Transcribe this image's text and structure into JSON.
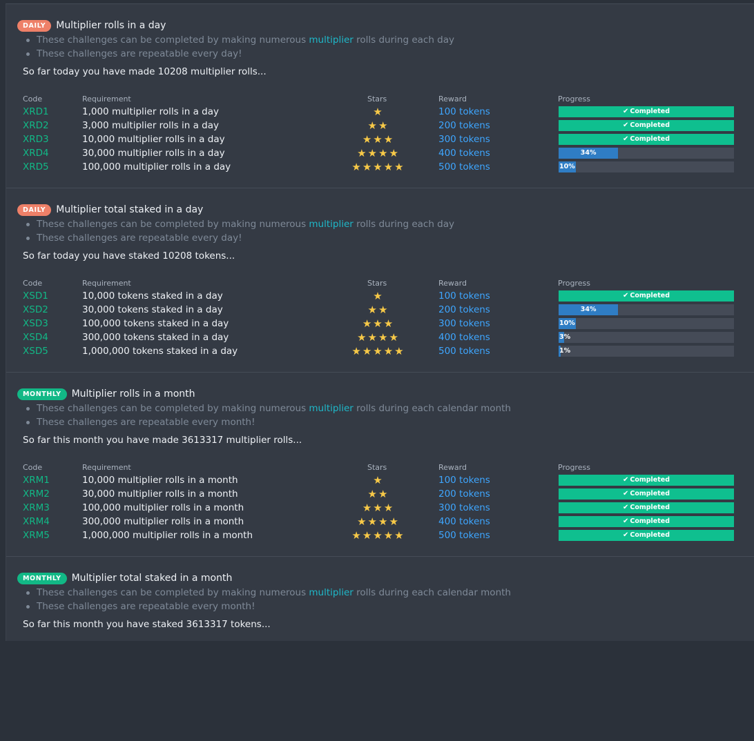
{
  "columns": {
    "code": "Code",
    "requirement": "Requirement",
    "stars": "Stars",
    "reward": "Reward",
    "progress": "Progress"
  },
  "completed_label": "Completed",
  "colors": {
    "daily_badge": "#ee8068",
    "monthly_badge": "#12b886",
    "completed": "#0fbf8f",
    "progress_fill": "#2f7dc4",
    "code": "#12b886",
    "reward": "#3ea6ff",
    "stars": "#f7c948"
  },
  "sections": [
    {
      "badge": "DAILY",
      "badge_type": "daily",
      "title": "Multiplier rolls in a day",
      "bullet1_pre": "These challenges can be completed by making numerous ",
      "bullet1_link": "multiplier",
      "bullet1_post": " rolls during each day",
      "bullet2": "These challenges are repeatable every day!",
      "summary": "So far today you have made 10208 multiplier rolls...",
      "rows": [
        {
          "code": "XRD1",
          "requirement": "1,000 multiplier rolls in a day",
          "stars": 1,
          "reward": "100 tokens",
          "progress": 100,
          "completed": true
        },
        {
          "code": "XRD2",
          "requirement": "3,000 multiplier rolls in a day",
          "stars": 2,
          "reward": "200 tokens",
          "progress": 100,
          "completed": true
        },
        {
          "code": "XRD3",
          "requirement": "10,000 multiplier rolls in a day",
          "stars": 3,
          "reward": "300 tokens",
          "progress": 100,
          "completed": true
        },
        {
          "code": "XRD4",
          "requirement": "30,000 multiplier rolls in a day",
          "stars": 4,
          "reward": "400 tokens",
          "progress": 34,
          "completed": false,
          "label": "34%"
        },
        {
          "code": "XRD5",
          "requirement": "100,000 multiplier rolls in a day",
          "stars": 5,
          "reward": "500 tokens",
          "progress": 10,
          "completed": false,
          "label": "10%"
        }
      ]
    },
    {
      "badge": "DAILY",
      "badge_type": "daily",
      "title": "Multiplier total staked in a day",
      "bullet1_pre": "These challenges can be completed by making numerous ",
      "bullet1_link": "multiplier",
      "bullet1_post": " rolls during each day",
      "bullet2": "These challenges are repeatable every day!",
      "summary": "So far today you have staked 10208 tokens...",
      "rows": [
        {
          "code": "XSD1",
          "requirement": "10,000 tokens staked in a day",
          "stars": 1,
          "reward": "100 tokens",
          "progress": 100,
          "completed": true
        },
        {
          "code": "XSD2",
          "requirement": "30,000 tokens staked in a day",
          "stars": 2,
          "reward": "200 tokens",
          "progress": 34,
          "completed": false,
          "label": "34%"
        },
        {
          "code": "XSD3",
          "requirement": "100,000 tokens staked in a day",
          "stars": 3,
          "reward": "300 tokens",
          "progress": 10,
          "completed": false,
          "label": "10%"
        },
        {
          "code": "XSD4",
          "requirement": "300,000 tokens staked in a day",
          "stars": 4,
          "reward": "400 tokens",
          "progress": 3,
          "completed": false,
          "label": "3%"
        },
        {
          "code": "XSD5",
          "requirement": "1,000,000 tokens staked in a day",
          "stars": 5,
          "reward": "500 tokens",
          "progress": 1,
          "completed": false,
          "label": "1%"
        }
      ]
    },
    {
      "badge": "MONTHLY",
      "badge_type": "monthly",
      "title": "Multiplier rolls in a month",
      "bullet1_pre": "These challenges can be completed by making numerous ",
      "bullet1_link": "multiplier",
      "bullet1_post": " rolls during each calendar month",
      "bullet2": "These challenges are repeatable every month!",
      "summary": "So far this month you have made 3613317 multiplier rolls...",
      "rows": [
        {
          "code": "XRM1",
          "requirement": "10,000 multiplier rolls in a month",
          "stars": 1,
          "reward": "100 tokens",
          "progress": 100,
          "completed": true
        },
        {
          "code": "XRM2",
          "requirement": "30,000 multiplier rolls in a month",
          "stars": 2,
          "reward": "200 tokens",
          "progress": 100,
          "completed": true
        },
        {
          "code": "XRM3",
          "requirement": "100,000 multiplier rolls in a month",
          "stars": 3,
          "reward": "300 tokens",
          "progress": 100,
          "completed": true
        },
        {
          "code": "XRM4",
          "requirement": "300,000 multiplier rolls in a month",
          "stars": 4,
          "reward": "400 tokens",
          "progress": 100,
          "completed": true
        },
        {
          "code": "XRM5",
          "requirement": "1,000,000 multiplier rolls in a month",
          "stars": 5,
          "reward": "500 tokens",
          "progress": 100,
          "completed": true
        }
      ]
    },
    {
      "badge": "MONTHLY",
      "badge_type": "monthly",
      "title": "Multiplier total staked in a month",
      "bullet1_pre": "These challenges can be completed by making numerous ",
      "bullet1_link": "multiplier",
      "bullet1_post": " rolls during each calendar month",
      "bullet2": "These challenges are repeatable every month!",
      "summary": "So far this month you have staked 3613317 tokens...",
      "rows": []
    }
  ]
}
